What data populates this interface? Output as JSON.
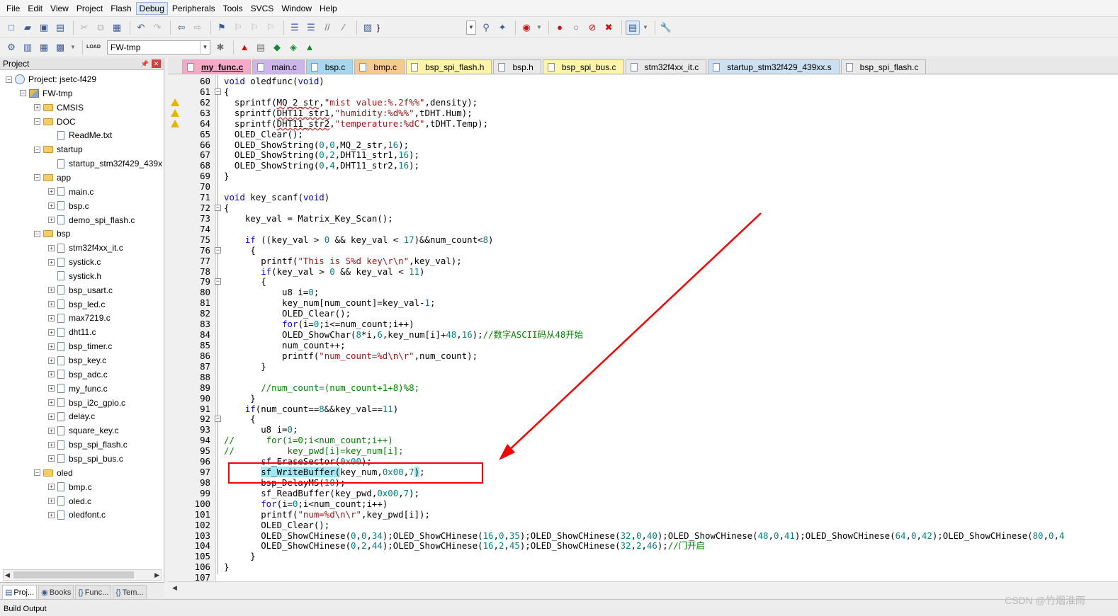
{
  "menubar": {
    "items": [
      "File",
      "Edit",
      "View",
      "Project",
      "Flash",
      "Debug",
      "Peripherals",
      "Tools",
      "SVCS",
      "Window",
      "Help"
    ],
    "active": "Debug"
  },
  "toolbar": {
    "brace_label": "}",
    "target_value": "FW-tmp",
    "load_label": "LOAD"
  },
  "project_panel": {
    "title": "Project",
    "tree": [
      {
        "label": "Project: jsetc-f429",
        "depth": 0,
        "kind": "project",
        "expander": "-"
      },
      {
        "label": "FW-tmp",
        "depth": 1,
        "kind": "target",
        "expander": "-"
      },
      {
        "label": "CMSIS",
        "depth": 2,
        "kind": "folder",
        "expander": "+"
      },
      {
        "label": "DOC",
        "depth": 2,
        "kind": "folder",
        "expander": "-"
      },
      {
        "label": "ReadMe.txt",
        "depth": 3,
        "kind": "file",
        "expander": ""
      },
      {
        "label": "startup",
        "depth": 2,
        "kind": "folder",
        "expander": "-"
      },
      {
        "label": "startup_stm32f429_439x",
        "depth": 3,
        "kind": "file",
        "expander": ""
      },
      {
        "label": "app",
        "depth": 2,
        "kind": "folder",
        "expander": "-"
      },
      {
        "label": "main.c",
        "depth": 3,
        "kind": "file",
        "expander": "+"
      },
      {
        "label": "bsp.c",
        "depth": 3,
        "kind": "file",
        "expander": "+"
      },
      {
        "label": "demo_spi_flash.c",
        "depth": 3,
        "kind": "file",
        "expander": "+"
      },
      {
        "label": "bsp",
        "depth": 2,
        "kind": "folder",
        "expander": "-"
      },
      {
        "label": "stm32f4xx_it.c",
        "depth": 3,
        "kind": "file",
        "expander": "+"
      },
      {
        "label": "systick.c",
        "depth": 3,
        "kind": "file",
        "expander": "+"
      },
      {
        "label": "systick.h",
        "depth": 3,
        "kind": "file",
        "expander": ""
      },
      {
        "label": "bsp_usart.c",
        "depth": 3,
        "kind": "file",
        "expander": "+"
      },
      {
        "label": "bsp_led.c",
        "depth": 3,
        "kind": "file",
        "expander": "+"
      },
      {
        "label": "max7219.c",
        "depth": 3,
        "kind": "file",
        "expander": "+"
      },
      {
        "label": "dht11.c",
        "depth": 3,
        "kind": "file",
        "expander": "+"
      },
      {
        "label": "bsp_timer.c",
        "depth": 3,
        "kind": "file",
        "expander": "+"
      },
      {
        "label": "bsp_key.c",
        "depth": 3,
        "kind": "file",
        "expander": "+"
      },
      {
        "label": "bsp_adc.c",
        "depth": 3,
        "kind": "file",
        "expander": "+"
      },
      {
        "label": "my_func.c",
        "depth": 3,
        "kind": "file",
        "expander": "+"
      },
      {
        "label": "bsp_i2c_gpio.c",
        "depth": 3,
        "kind": "file",
        "expander": "+"
      },
      {
        "label": "delay.c",
        "depth": 3,
        "kind": "file",
        "expander": "+"
      },
      {
        "label": "square_key.c",
        "depth": 3,
        "kind": "file",
        "expander": "+"
      },
      {
        "label": "bsp_spi_flash.c",
        "depth": 3,
        "kind": "file",
        "expander": "+"
      },
      {
        "label": "bsp_spi_bus.c",
        "depth": 3,
        "kind": "file",
        "expander": "+"
      },
      {
        "label": "oled",
        "depth": 2,
        "kind": "folder",
        "expander": "-"
      },
      {
        "label": "bmp.c",
        "depth": 3,
        "kind": "file",
        "expander": "+"
      },
      {
        "label": "oled.c",
        "depth": 3,
        "kind": "file",
        "expander": "+"
      },
      {
        "label": "oledfont.c",
        "depth": 3,
        "kind": "file",
        "expander": "+"
      }
    ],
    "tabs": [
      {
        "label": "Proj...",
        "active": true
      },
      {
        "label": "Books",
        "active": false
      },
      {
        "label": "Func...",
        "active": false
      },
      {
        "label": "Tem...",
        "active": false
      }
    ]
  },
  "file_tabs": [
    {
      "label": "my_func.c",
      "color": "#f6a9c6",
      "active": true
    },
    {
      "label": "main.c",
      "color": "#cdb4ea",
      "active": false
    },
    {
      "label": "bsp.c",
      "color": "#a5d8f0",
      "active": false
    },
    {
      "label": "bmp.c",
      "color": "#f8c98f",
      "active": false
    },
    {
      "label": "bsp_spi_flash.h",
      "color": "#fff5a8",
      "active": false
    },
    {
      "label": "bsp.h",
      "color": "#e9e9e9",
      "active": false
    },
    {
      "label": "bsp_spi_bus.c",
      "color": "#fff5a8",
      "active": false
    },
    {
      "label": "stm32f4xx_it.c",
      "color": "#e9e9e9",
      "active": false
    },
    {
      "label": "startup_stm32f429_439xx.s",
      "color": "#cde0f2",
      "active": false
    },
    {
      "label": "bsp_spi_flash.c",
      "color": "#e9e9e9",
      "active": false
    }
  ],
  "code_lines": [
    {
      "n": "60",
      "code": [
        {
          "t": "void",
          "k": "kw"
        },
        {
          "t": " oledfunc("
        },
        {
          "t": "void",
          "k": "kw"
        },
        {
          "t": ")"
        }
      ]
    },
    {
      "n": "61",
      "fold": true,
      "code": [
        {
          "t": "{"
        }
      ]
    },
    {
      "n": "62",
      "warn": true,
      "code": [
        {
          "t": "  sprintf("
        },
        {
          "t": "MQ_2_str",
          "k": "sq"
        },
        {
          "t": ","
        },
        {
          "t": "\"mist value:%.2f%%\"",
          "k": "str"
        },
        {
          "t": ",density);"
        }
      ]
    },
    {
      "n": "63",
      "warn": true,
      "code": [
        {
          "t": "  sprintf("
        },
        {
          "t": "DHT11_str1",
          "k": "sq"
        },
        {
          "t": ","
        },
        {
          "t": "\"humidity:%d%%\"",
          "k": "str"
        },
        {
          "t": ",tDHT.Hum);"
        }
      ]
    },
    {
      "n": "64",
      "warn": true,
      "code": [
        {
          "t": "  sprintf("
        },
        {
          "t": "DHT11_str2",
          "k": "sq"
        },
        {
          "t": ","
        },
        {
          "t": "\"temperature:%dC\"",
          "k": "str"
        },
        {
          "t": ",tDHT.Temp);"
        }
      ]
    },
    {
      "n": "65",
      "code": [
        {
          "t": "  OLED_Clear();"
        }
      ]
    },
    {
      "n": "66",
      "code": [
        {
          "t": "  OLED_ShowString("
        },
        {
          "t": "0",
          "k": "num"
        },
        {
          "t": ","
        },
        {
          "t": "0",
          "k": "num"
        },
        {
          "t": ",MQ_2_str,"
        },
        {
          "t": "16",
          "k": "num"
        },
        {
          "t": ");"
        }
      ]
    },
    {
      "n": "67",
      "code": [
        {
          "t": "  OLED_ShowString("
        },
        {
          "t": "0",
          "k": "num"
        },
        {
          "t": ","
        },
        {
          "t": "2",
          "k": "num"
        },
        {
          "t": ",DHT11_str1,"
        },
        {
          "t": "16",
          "k": "num"
        },
        {
          "t": ");"
        }
      ]
    },
    {
      "n": "68",
      "code": [
        {
          "t": "  OLED_ShowString("
        },
        {
          "t": "0",
          "k": "num"
        },
        {
          "t": ","
        },
        {
          "t": "4",
          "k": "num"
        },
        {
          "t": ",DHT11_str2,"
        },
        {
          "t": "16",
          "k": "num"
        },
        {
          "t": ");"
        }
      ]
    },
    {
      "n": "69",
      "code": [
        {
          "t": "}"
        }
      ]
    },
    {
      "n": "70",
      "code": []
    },
    {
      "n": "71",
      "code": [
        {
          "t": "void",
          "k": "kw"
        },
        {
          "t": " key_scanf("
        },
        {
          "t": "void",
          "k": "kw"
        },
        {
          "t": ")"
        }
      ]
    },
    {
      "n": "72",
      "fold": true,
      "code": [
        {
          "t": "{"
        }
      ]
    },
    {
      "n": "73",
      "code": [
        {
          "t": "    key_val = Matrix_Key_Scan();"
        }
      ]
    },
    {
      "n": "74",
      "code": []
    },
    {
      "n": "75",
      "code": [
        {
          "t": "    "
        },
        {
          "t": "if",
          "k": "kw"
        },
        {
          "t": " ((key_val > "
        },
        {
          "t": "0",
          "k": "num"
        },
        {
          "t": " && key_val < "
        },
        {
          "t": "17",
          "k": "num"
        },
        {
          "t": ")&&num_count<"
        },
        {
          "t": "8",
          "k": "num"
        },
        {
          "t": ")"
        }
      ]
    },
    {
      "n": "76",
      "fold": true,
      "code": [
        {
          "t": "     {"
        }
      ]
    },
    {
      "n": "77",
      "code": [
        {
          "t": "       printf("
        },
        {
          "t": "\"This is S%d key\\r\\n\"",
          "k": "str"
        },
        {
          "t": ",key_val);"
        }
      ]
    },
    {
      "n": "78",
      "code": [
        {
          "t": "       "
        },
        {
          "t": "if",
          "k": "kw"
        },
        {
          "t": "(key_val > "
        },
        {
          "t": "0",
          "k": "num"
        },
        {
          "t": " && key_val < "
        },
        {
          "t": "11",
          "k": "num"
        },
        {
          "t": ")"
        }
      ]
    },
    {
      "n": "79",
      "fold": true,
      "code": [
        {
          "t": "       {"
        }
      ]
    },
    {
      "n": "80",
      "code": [
        {
          "t": "           u8 i="
        },
        {
          "t": "0",
          "k": "num"
        },
        {
          "t": ";"
        }
      ]
    },
    {
      "n": "81",
      "code": [
        {
          "t": "           key_num[num_count]=key_val-"
        },
        {
          "t": "1",
          "k": "num"
        },
        {
          "t": ";"
        }
      ]
    },
    {
      "n": "82",
      "code": [
        {
          "t": "           OLED_Clear();"
        }
      ]
    },
    {
      "n": "83",
      "code": [
        {
          "t": "           "
        },
        {
          "t": "for",
          "k": "kw"
        },
        {
          "t": "(i="
        },
        {
          "t": "0",
          "k": "num"
        },
        {
          "t": ";i<=num_count;i++)"
        }
      ]
    },
    {
      "n": "84",
      "code": [
        {
          "t": "           OLED_ShowChar("
        },
        {
          "t": "8",
          "k": "num"
        },
        {
          "t": "*i,"
        },
        {
          "t": "6",
          "k": "num"
        },
        {
          "t": ",key_num[i]+"
        },
        {
          "t": "48",
          "k": "num"
        },
        {
          "t": ","
        },
        {
          "t": "16",
          "k": "num"
        },
        {
          "t": ");"
        },
        {
          "t": "//数字ASCII码从48开始",
          "k": "cmt"
        }
      ]
    },
    {
      "n": "85",
      "code": [
        {
          "t": "           num_count++;"
        }
      ]
    },
    {
      "n": "86",
      "code": [
        {
          "t": "           printf("
        },
        {
          "t": "\"num_count=%d\\n\\r\"",
          "k": "str"
        },
        {
          "t": ",num_count);"
        }
      ]
    },
    {
      "n": "87",
      "code": [
        {
          "t": "       }"
        }
      ]
    },
    {
      "n": "88",
      "code": []
    },
    {
      "n": "89",
      "code": [
        {
          "t": "       "
        },
        {
          "t": "//num_count=(num_count+1+8)%8;",
          "k": "cmt"
        }
      ]
    },
    {
      "n": "90",
      "code": [
        {
          "t": "     }"
        }
      ]
    },
    {
      "n": "91",
      "code": [
        {
          "t": "    "
        },
        {
          "t": "if",
          "k": "kw"
        },
        {
          "t": "(num_count=="
        },
        {
          "t": "8",
          "k": "num"
        },
        {
          "t": "&&key_val=="
        },
        {
          "t": "11",
          "k": "num"
        },
        {
          "t": ")"
        }
      ]
    },
    {
      "n": "92",
      "fold": true,
      "code": [
        {
          "t": "     {"
        }
      ]
    },
    {
      "n": "93",
      "code": [
        {
          "t": "       u8 i="
        },
        {
          "t": "0",
          "k": "num"
        },
        {
          "t": ";"
        }
      ]
    },
    {
      "n": "94",
      "code": [
        {
          "t": "//      for(i=0;i<num_count;i++)",
          "k": "cmt"
        }
      ]
    },
    {
      "n": "95",
      "code": [
        {
          "t": "//          key_pwd[i]=key_num[i];",
          "k": "cmt"
        }
      ]
    },
    {
      "n": "96",
      "code": [
        {
          "t": "       sf_EraseSector("
        },
        {
          "t": "0x00",
          "k": "num"
        },
        {
          "t": ");"
        }
      ]
    },
    {
      "n": "97",
      "code": [
        {
          "t": "       "
        },
        {
          "t": "sf_WriteBuffer",
          "k": "hl"
        },
        {
          "t": "(",
          "k": "hl"
        },
        {
          "t": "key_num,"
        },
        {
          "t": "0x00",
          "k": "num"
        },
        {
          "t": ","
        },
        {
          "t": "7",
          "k": "num"
        },
        {
          "t": ")",
          "k": "hl"
        },
        {
          "t": ";"
        }
      ]
    },
    {
      "n": "98",
      "code": [
        {
          "t": "       bsp_DelayMS("
        },
        {
          "t": "10",
          "k": "num"
        },
        {
          "t": ");"
        }
      ]
    },
    {
      "n": "99",
      "code": [
        {
          "t": "       sf_ReadBuffer(key_pwd,"
        },
        {
          "t": "0x00",
          "k": "num"
        },
        {
          "t": ","
        },
        {
          "t": "7",
          "k": "num"
        },
        {
          "t": ");"
        }
      ]
    },
    {
      "n": "100",
      "code": [
        {
          "t": "       "
        },
        {
          "t": "for",
          "k": "kw"
        },
        {
          "t": "(i="
        },
        {
          "t": "0",
          "k": "num"
        },
        {
          "t": ";i<num_count;i++)"
        }
      ]
    },
    {
      "n": "101",
      "code": [
        {
          "t": "       printf("
        },
        {
          "t": "\"num=%d\\n\\r\"",
          "k": "str"
        },
        {
          "t": ",key_pwd[i]);"
        }
      ]
    },
    {
      "n": "102",
      "code": [
        {
          "t": "       OLED_Clear();"
        }
      ]
    },
    {
      "n": "103",
      "code": [
        {
          "t": "       OLED_ShowCHinese("
        },
        {
          "t": "0",
          "k": "num"
        },
        {
          "t": ","
        },
        {
          "t": "0",
          "k": "num"
        },
        {
          "t": ","
        },
        {
          "t": "34",
          "k": "num"
        },
        {
          "t": ");OLED_ShowCHinese("
        },
        {
          "t": "16",
          "k": "num"
        },
        {
          "t": ","
        },
        {
          "t": "0",
          "k": "num"
        },
        {
          "t": ","
        },
        {
          "t": "35",
          "k": "num"
        },
        {
          "t": ");OLED_ShowCHinese("
        },
        {
          "t": "32",
          "k": "num"
        },
        {
          "t": ","
        },
        {
          "t": "0",
          "k": "num"
        },
        {
          "t": ","
        },
        {
          "t": "40",
          "k": "num"
        },
        {
          "t": ");OLED_ShowCHinese("
        },
        {
          "t": "48",
          "k": "num"
        },
        {
          "t": ","
        },
        {
          "t": "0",
          "k": "num"
        },
        {
          "t": ","
        },
        {
          "t": "41",
          "k": "num"
        },
        {
          "t": ");OLED_ShowCHinese("
        },
        {
          "t": "64",
          "k": "num"
        },
        {
          "t": ","
        },
        {
          "t": "0",
          "k": "num"
        },
        {
          "t": ","
        },
        {
          "t": "42",
          "k": "num"
        },
        {
          "t": ");OLED_ShowCHinese("
        },
        {
          "t": "80",
          "k": "num"
        },
        {
          "t": ","
        },
        {
          "t": "0",
          "k": "num"
        },
        {
          "t": ","
        },
        {
          "t": "4",
          "k": "num"
        }
      ]
    },
    {
      "n": "104",
      "code": [
        {
          "t": "       OLED_ShowCHinese("
        },
        {
          "t": "0",
          "k": "num"
        },
        {
          "t": ","
        },
        {
          "t": "2",
          "k": "num"
        },
        {
          "t": ","
        },
        {
          "t": "44",
          "k": "num"
        },
        {
          "t": ");OLED_ShowCHinese("
        },
        {
          "t": "16",
          "k": "num"
        },
        {
          "t": ","
        },
        {
          "t": "2",
          "k": "num"
        },
        {
          "t": ","
        },
        {
          "t": "45",
          "k": "num"
        },
        {
          "t": ");OLED_ShowCHinese("
        },
        {
          "t": "32",
          "k": "num"
        },
        {
          "t": ","
        },
        {
          "t": "2",
          "k": "num"
        },
        {
          "t": ","
        },
        {
          "t": "46",
          "k": "num"
        },
        {
          "t": ");"
        },
        {
          "t": "//门开启",
          "k": "cmt"
        }
      ]
    },
    {
      "n": "105",
      "code": [
        {
          "t": "     }"
        }
      ]
    },
    {
      "n": "106",
      "code": [
        {
          "t": "}"
        }
      ]
    },
    {
      "n": "107",
      "code": []
    }
  ],
  "build_output": {
    "label": "Build Output"
  },
  "watermark": "CSDN @竹烟淮雨",
  "colors": {
    "annotation": "#ff0000",
    "keyword": "#0000ff",
    "number": "#008080",
    "string": "#a31515",
    "comment": "#008000",
    "highlight": "#9fe8ef"
  }
}
